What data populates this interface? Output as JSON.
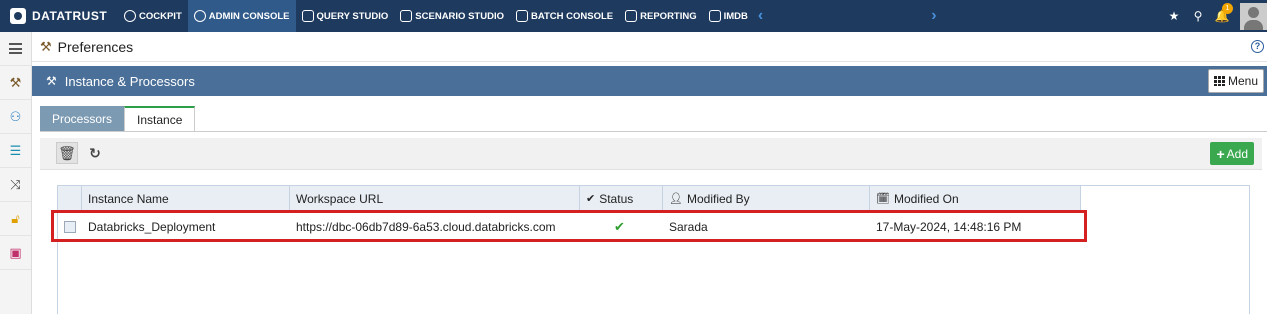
{
  "brand": {
    "name": "DATATRUST"
  },
  "nav": {
    "items": [
      {
        "label": "COCKPIT",
        "active": false
      },
      {
        "label": "ADMIN CONSOLE",
        "active": true
      },
      {
        "label": "QUERY STUDIO",
        "active": false
      },
      {
        "label": "SCENARIO STUDIO",
        "active": false
      },
      {
        "label": "BATCH CONSOLE",
        "active": false
      },
      {
        "label": "REPORTING",
        "active": false
      },
      {
        "label": "IMDB",
        "active": false
      }
    ],
    "notification_count": "1"
  },
  "preferences": {
    "title": "Preferences",
    "help": "?"
  },
  "section": {
    "title": "Instance & Processors",
    "menu_label": "Menu"
  },
  "tabs": [
    {
      "label": "Processors",
      "active": false
    },
    {
      "label": "Instance",
      "active": true
    }
  ],
  "toolbar": {
    "add_label": "Add"
  },
  "table": {
    "columns": [
      "Instance Name",
      "Workspace URL",
      "Status",
      "Modified By",
      "Modified On"
    ],
    "rows": [
      {
        "instance_name": "Databricks_Deployment",
        "workspace_url": "https://dbc-06db7d89-6a53.cloud.databricks.com",
        "status": "active",
        "modified_by": "Sarada",
        "modified_on": "17-May-2024, 14:48:16 PM"
      }
    ]
  },
  "colors": {
    "topbar": "#1e3a5f",
    "section_bar": "#4a6f98",
    "add_button": "#3aa84f",
    "highlight": "#d42020"
  }
}
